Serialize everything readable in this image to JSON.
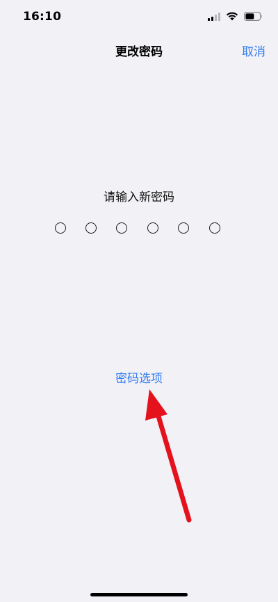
{
  "status_bar": {
    "time": "16:10",
    "icons": [
      "cellular-signal-icon",
      "wifi-icon",
      "battery-icon"
    ]
  },
  "nav": {
    "title": "更改密码",
    "cancel_label": "取消"
  },
  "prompt": "请输入新密码",
  "passcode": {
    "length": 6,
    "entered": 0
  },
  "options_label": "密码选项",
  "overlay": {
    "annotation": "red-arrow-icon",
    "color": "#e3121d"
  },
  "colors": {
    "accent": "#2f7bf0",
    "background": "#f2f1f6"
  }
}
